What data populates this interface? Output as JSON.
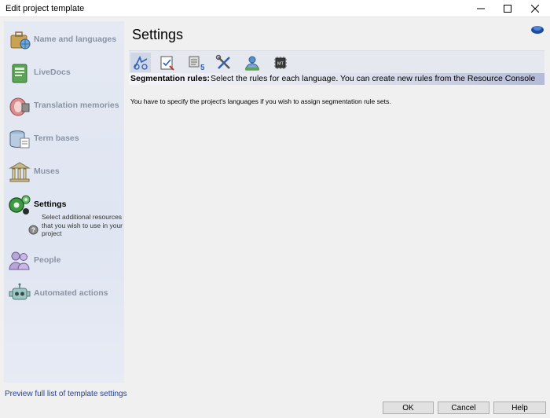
{
  "window": {
    "title": "Edit project template",
    "minimize_icon": "minimize-icon",
    "maximize_icon": "maximize-icon",
    "close_icon": "close-icon"
  },
  "sidebar": {
    "items": [
      {
        "label": "Name and languages",
        "icon": "suitcase-globe-icon"
      },
      {
        "label": "LiveDocs",
        "icon": "livedocs-book-icon"
      },
      {
        "label": "Translation memories",
        "icon": "translation-memory-icon"
      },
      {
        "label": "Term bases",
        "icon": "term-base-icon"
      },
      {
        "label": "Muses",
        "icon": "muse-temple-icon"
      },
      {
        "label": "Settings",
        "icon": "settings-gears-icon"
      },
      {
        "label": "People",
        "icon": "people-icon"
      },
      {
        "label": "Automated actions",
        "icon": "robot-icon"
      }
    ],
    "active_index": 5,
    "settings_description": "Select additional resources that you wish to use in your project"
  },
  "footer": {
    "preview_link": "Preview full list of template settings",
    "ok_label": "OK",
    "cancel_label": "Cancel",
    "help_label": "Help"
  },
  "main": {
    "title": "Settings",
    "toolbar_icons": [
      "segmentation-rules-icon",
      "qa-settings-icon",
      "font-settings-icon",
      "tools-icon",
      "lqa-person-icon",
      "mt-chip-icon"
    ],
    "rules_label": "Segmentation rules:",
    "rules_description": "Select the rules for each language. You can create new rules from the Resource Console",
    "info_text": "You have to specify the project's languages if you wish to assign segmentation rule sets."
  },
  "colors": {
    "accent_blue": "#1d3fa8",
    "sidebar_bg": "#e2e7f2",
    "active_label": "#000000",
    "inactive_label": "#8a93a3"
  }
}
